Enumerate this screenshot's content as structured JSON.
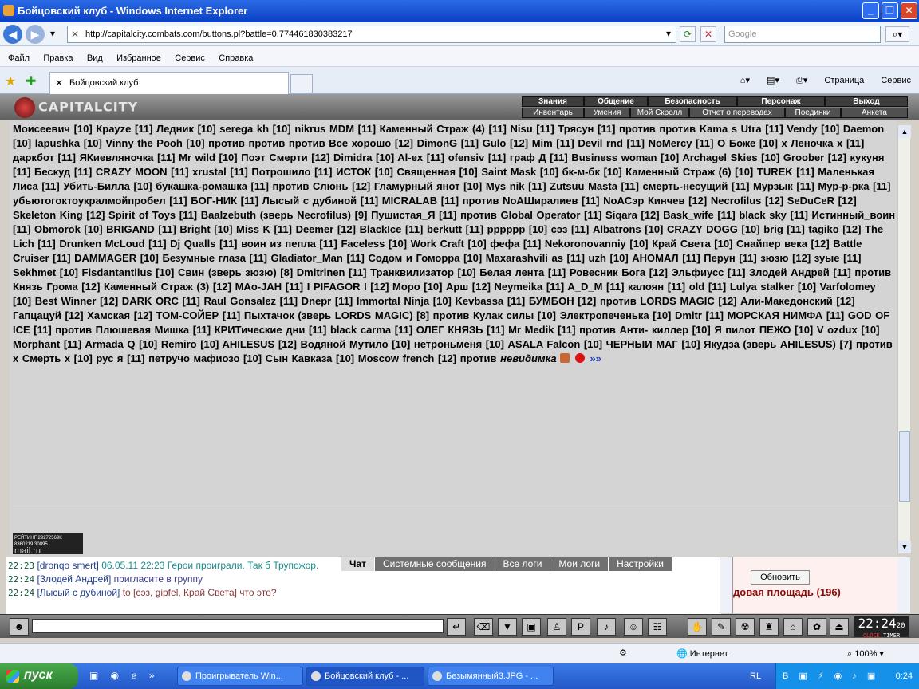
{
  "window": {
    "title": "Бойцовский клуб - Windows Internet Explorer",
    "url": "http://capitalcity.combats.com/buttons.pl?battle=0.774461830383217",
    "search_placeholder": "Google",
    "menu": [
      "Файл",
      "Правка",
      "Вид",
      "Избранное",
      "Сервис",
      "Справка"
    ],
    "tab_title": "Бойцовский клуб",
    "tools": [
      "Страница",
      "Сервис"
    ],
    "status_zone": "Интернет",
    "zoom": "100%"
  },
  "game": {
    "logo": "CAPITALCITY",
    "nav_top": [
      "Знания",
      "Общение",
      "Безопасность",
      "Персонаж",
      "Выход"
    ],
    "nav_bottom": [
      "Инвентарь",
      "Умения",
      "Мой Єкролл",
      "Отчет о переводах",
      "Поединки",
      "Анкета"
    ],
    "players_text": "Моисеевич [10] Крауze [11] Ледник [10] serega kh [10] nikrus MDM [11] Каменный Страж (4) [11] Nisu [11] Трясун [11] против против Kama s Utra [11] Vendy [10] Daemon [10] lapushka [10] Vinny the Pooh [10] против против против Все хорошо [12] DimonG [11] Gulo [12] Mim [11] Devil rnd [11] NoMercy [11] О Боже [10] x Леночка x [11] даркбот [11] ЯКиевляночка [11] Mr wild [10] Поэт Смерти [12] Dimidra [10] Al-ex [11] ofensiv [11] граф Д [11] Business woman [10] Archagel Skies [10] Groober [12] кукуня [11] Бескуд [11] CRAZY MOON [11] xrustal [11] Потрошило [11] ИСТОК [10] Священная [10] Saint Mask [10] бк-м-бк [10] Каменный Страж (6) [10] TUREK [11] Маленькая Лиса [11] Убить-Билла [10] букашка-ромашка [11] против Слюнь [12] Гламурный янот [10] Mys nik [11] Zutsuu Masta [11] смерть-несущий [11] Мурзык [11] Мур-р-рка [11] убьютогоктоукралмойпробел [11] БОГ-НИК [11] Лысый с дубиной [11] MICRALAB [11] против NoAШиралиев [11] NoAСэр Кинчев [12] Necrofilus [12] SeDuCeR [12] Skeleton King [12] Spirit of Toys [11] Baalzebuth (зверь Necrofilus) [9] Пушистая_Я [11] против Global Operator [11] Siqara [12] Bask_wife [11] black sky [11] Истинный_воин [11] Obmorok [10] BRIGAND [11] Bright [10] Miss K [11] Deemer [12] BlackIce [11] berkutt [11] pppppp [10] сэз [11] Albatrons [10] CRAZY DOGG [10] brig [11] tagiko [12] The Lich [11] Drunken McLoud [11] Dj Qualls [11] воин из пепла [11] Faceless [10] Work Craft [10] фефа [11] Nekoronovanniy [10] Край Света [10] Снайпер века [12] Battle Cruiser [11] DAMMAGER [10] Безумные глаза [11] Gladiator_Man [11] Содом и Гоморра [10] Maxarashvili as [11] uzh [10] АНОМАЛ [11] Перун [11] зюзю [12] зуые [11] Sekhmet [10] Fisdantantilus [10] Свин (зверь зюзю) [8] Dmitrinen [11] Транквилизатор [10] Белая лента [11] Ровесник Бога [12] Эльфиусс [11] Злодей Андрей [11] против Князь Грома [12] Каменный Страж (3) [12] MAo-JAH [11] I PIFAGOR I [12] Moро [10] Арш [12] Neymeika [11] A_D_M [11] калоян [11] old [11] Lulya stalker [10] Varfolomey [10] Best Winner [12] DARK ORC [11] Raul Gonsalez [11] Dnepr [11] Immortal Ninja [10] Kevbassa [11] БУМБОН [12] против LORDS MAGIC [12] Али-Македонский [12] Гапцацуй [12] Хамская [12] ТОМ-СОЙЕР [11] Пыхтачок (зверь LORDS MAGIC) [8] против Кулак силы [10] Электропеченька [10] Dmitr [11] МОРСКАЯ НИМФА [11] GOD OF ICE [11] против Плюшевая Мишка [11] КРИТические дни [11] black carma [11] ОЛЕГ КНЯЗЬ [11] Mr Medik [11] против Анти- киллер [10] Я пилот ПЕЖО [10] V ozdux [10] Morphant [11] Armada Q [10] Remiro [10] AHILESUS [12] Водяной Мутило [10] нетроньменя [10] ASALA Falcon [10] ЧЕРНЫИ МАГ [10] Якудза (зверь AHILESUS) [7] против х Смерть х [10] рус я [11] петручо мафиозо [10] Сын Кавказа [10] Moscow french [12] против",
    "hidden_label": "невидимка",
    "more_label": "»»",
    "counter_rating": "РЕЙТИНГ 29272569К",
    "counter_nums": "8360219  30895",
    "counter_brand": "mail.ru"
  },
  "chat": {
    "tabs": [
      "Чат",
      "Системные сообщения",
      "Все логи",
      "Мои логи",
      "Настройки"
    ],
    "lines": [
      {
        "time": "22:23",
        "nick": "[dronqo smert]",
        "text": "06.05.11 22:23 Герои проиграли. Так б Трупожор."
      },
      {
        "time": "22:24",
        "nick": "[Злодей Андрей]",
        "text": "пригласите в группу"
      },
      {
        "time": "22:24",
        "nick": "[Лысый с дубиной]",
        "to": "to [сэз, gipfel, Край Света]",
        "text": "что это?"
      }
    ],
    "refresh_label": "Обновить",
    "location": "довая площадь (196)"
  },
  "clock": {
    "time": "22:24",
    "seconds": "20",
    "label_clock": "CLOCK",
    "label_timer": "TIMER"
  },
  "taskbar": {
    "start": "пуск",
    "items": [
      "Проигрыватель Win...",
      "Бойцовский клуб - ...",
      "Безымянный3.JPG - ..."
    ],
    "lang": "RL",
    "time": "0:24"
  }
}
